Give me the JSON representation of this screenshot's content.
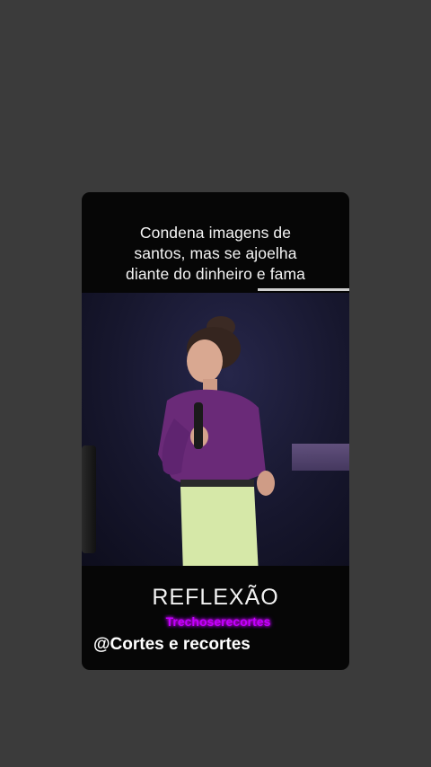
{
  "story": {
    "caption_lines": [
      "Condena imagens de",
      "santos, mas  se ajoelha",
      "diante do dinheiro e fama"
    ],
    "title": "REFLEXÃO",
    "watermark": "Trechoserecortes",
    "handle": "@Cortes e recortes"
  },
  "colors": {
    "background": "#3b3b3b",
    "card": "#060606",
    "watermark": "#c000ff",
    "shirt": "#6a2a78",
    "pants": "#d6e8a8"
  }
}
